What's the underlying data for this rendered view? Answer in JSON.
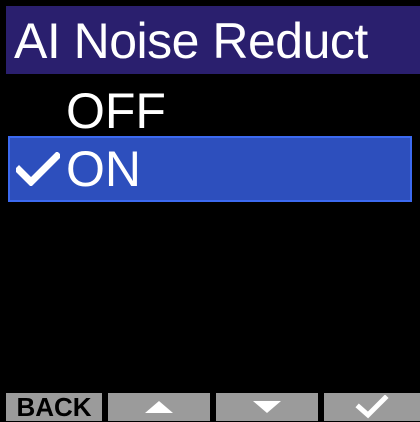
{
  "title_bar": {
    "title": "AI Noise Reduct",
    "background": "#2a1f6e"
  },
  "menu": {
    "items": [
      {
        "label": "OFF",
        "selected": false
      },
      {
        "label": "ON",
        "selected": true,
        "checked": true,
        "icon": "check-icon"
      }
    ],
    "highlight_color": "#2d4fbd"
  },
  "softkeys": {
    "back_label": "BACK",
    "up_icon": "triangle-up-icon",
    "down_icon": "triangle-down-icon",
    "enter_icon": "check-icon",
    "color": "#9b9b9b"
  }
}
